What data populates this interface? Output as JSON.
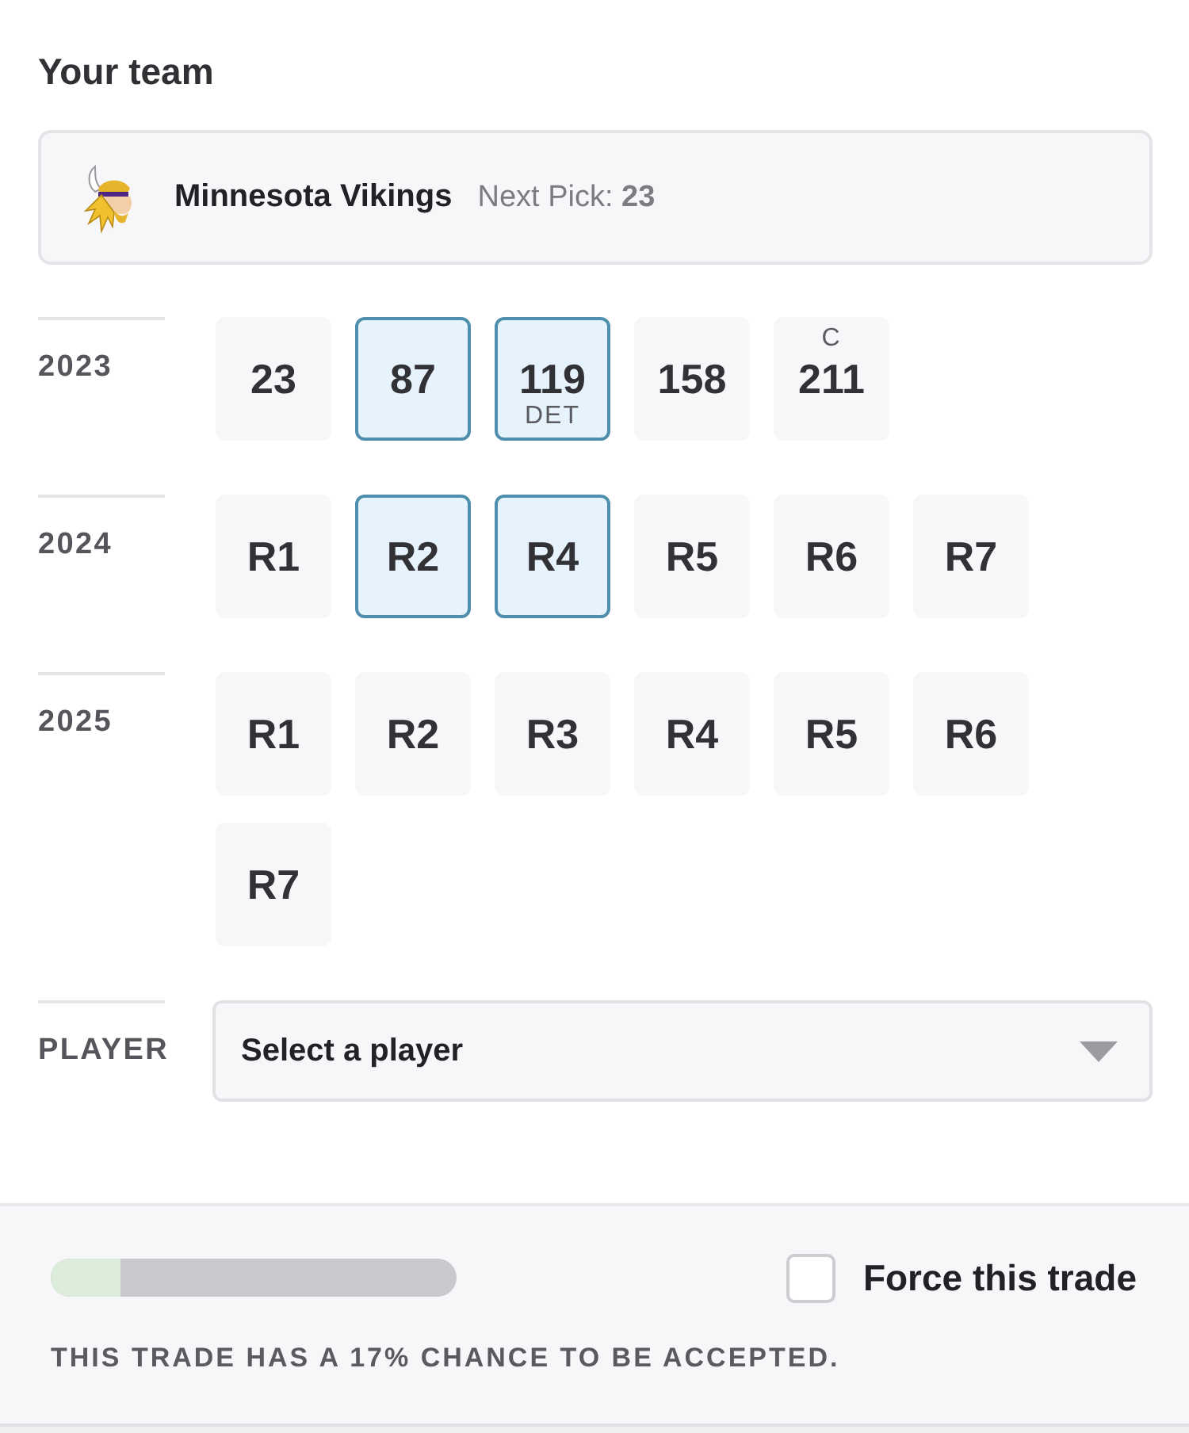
{
  "heading": "Your team",
  "team": {
    "name": "Minnesota Vikings",
    "next_pick_label": "Next Pick:",
    "next_pick": "23"
  },
  "years": [
    {
      "label": "2023",
      "picks": [
        {
          "label": "23",
          "selected": false
        },
        {
          "label": "87",
          "selected": true
        },
        {
          "label": "119",
          "bottom": "DET",
          "selected": true
        },
        {
          "label": "158",
          "selected": false
        },
        {
          "label": "211",
          "top": "C",
          "selected": false
        }
      ]
    },
    {
      "label": "2024",
      "picks": [
        {
          "label": "R1",
          "selected": false
        },
        {
          "label": "R2",
          "selected": true
        },
        {
          "label": "R4",
          "selected": true
        },
        {
          "label": "R5",
          "selected": false
        },
        {
          "label": "R6",
          "selected": false
        },
        {
          "label": "R7",
          "selected": false
        }
      ]
    },
    {
      "label": "2025",
      "picks": [
        {
          "label": "R1",
          "selected": false
        },
        {
          "label": "R2",
          "selected": false
        },
        {
          "label": "R3",
          "selected": false
        },
        {
          "label": "R4",
          "selected": false
        },
        {
          "label": "R5",
          "selected": false
        },
        {
          "label": "R6",
          "selected": false
        },
        {
          "label": "R7",
          "selected": false
        }
      ]
    }
  ],
  "player": {
    "label": "PLAYER",
    "value": "Select a player"
  },
  "footer": {
    "chance": {
      "level": 0.17
    },
    "force_trade": {
      "label": "Force this trade",
      "checked": false
    },
    "message": "THIS TRADE HAS A 17% CHANCE TO BE ACCEPTED."
  }
}
